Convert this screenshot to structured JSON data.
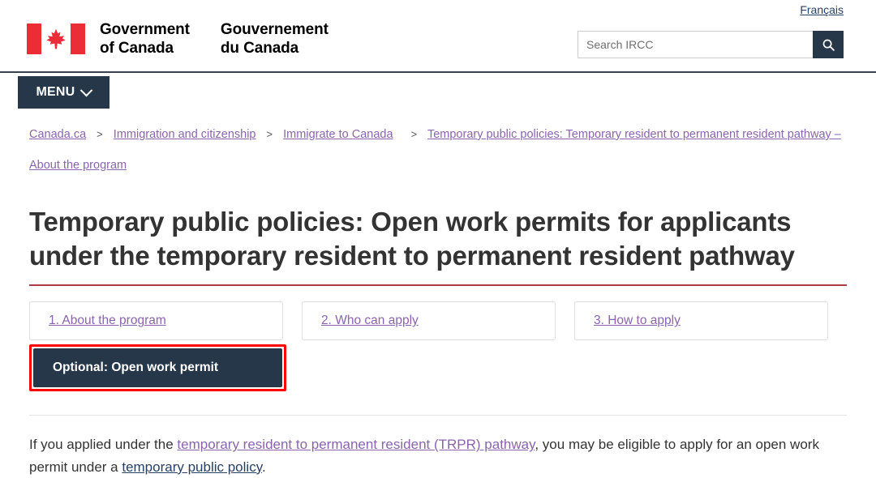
{
  "header": {
    "language_toggle": "Français",
    "wordmark_en": "Government\nof Canada",
    "wordmark_fr": "Gouvernement\ndu Canada",
    "flag_icon": "canada-flag-icon",
    "search": {
      "placeholder": "Search IRCC",
      "value": "",
      "button_icon": "search-icon"
    }
  },
  "menu": {
    "label": "MENU",
    "icon": "chevron-down-icon"
  },
  "breadcrumb": {
    "separator": ">",
    "items": [
      {
        "label": "Canada.ca"
      },
      {
        "label": "Immigration and citizenship"
      },
      {
        "label": "Immigrate to Canada"
      },
      {
        "label": "Temporary public policies: Temporary resident to permanent resident pathway – About the program"
      }
    ]
  },
  "main": {
    "page_title": "Temporary public policies: Open work permits for applicants under the temporary resident to permanent resident pathway",
    "tabs": [
      {
        "label": "1. About the program",
        "active": false
      },
      {
        "label": "2. Who can apply",
        "active": false
      },
      {
        "label": "3. How to apply",
        "active": false
      },
      {
        "label": "Optional: Open work permit",
        "active": true
      }
    ],
    "paragraph": {
      "part1": "If you applied under the ",
      "link1": "temporary resident to permanent resident (TRPR) pathway",
      "part2": ", you may be eligible to apply for an open work permit under a ",
      "link2": "temporary public policy",
      "part3": "."
    }
  },
  "colors": {
    "flag_red": "#ea2d37",
    "nav_dark": "#26374a",
    "title_rule": "#af3c43",
    "visited_link": "#8a64ad",
    "link": "#284162",
    "highlight_border": "#ff0000"
  }
}
